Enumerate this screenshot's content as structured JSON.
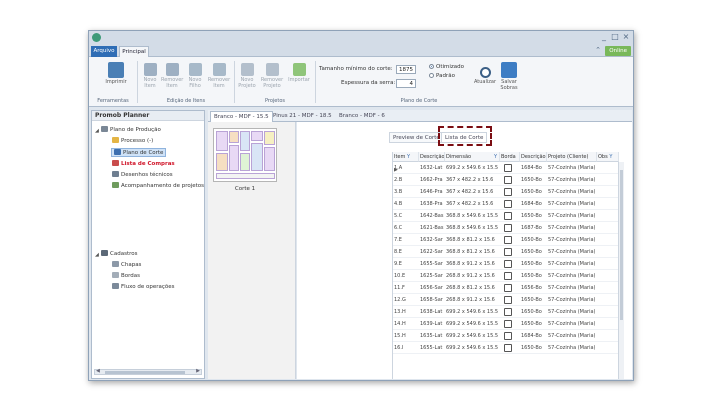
{
  "colors": {
    "accent": "#2f6db5",
    "highlight_red": "#d1162a",
    "focus_box": "#7b0d12",
    "badge_green": "#79b85a"
  },
  "window": {
    "controls": [
      "_",
      "□",
      "×"
    ]
  },
  "menu": {
    "tab_arquivo": "Arquivo",
    "tab_principal": "Principal",
    "badge": "Online"
  },
  "ribbon": {
    "buttons": [
      {
        "label": "Imprimir",
        "icon": "printer-icon"
      },
      {
        "label": "Novo Item",
        "icon": "new-item-icon"
      },
      {
        "label": "Remover Item",
        "icon": "remove-item-icon"
      },
      {
        "label": "Novo Filho",
        "icon": "new-child-icon"
      },
      {
        "label": "Remover Item",
        "icon": "remove-item-icon"
      },
      {
        "label": "Novo Projeto",
        "icon": "new-project-icon"
      },
      {
        "label": "Remover Projeto",
        "icon": "remove-project-icon"
      },
      {
        "label": "Importar",
        "icon": "import-icon"
      },
      {
        "label": "Atualizar",
        "icon": "refresh-icon"
      },
      {
        "label": "Salvar Sobras",
        "icon": "save-scraps-icon"
      }
    ],
    "groups": [
      "Ferramentas",
      "Edição de Itens",
      "Projetos",
      "Plano de Corte"
    ],
    "fields": {
      "tamanho_label": "Tamanho mínimo do corte:",
      "tamanho_value": "1875",
      "espessura_label": "Espessura da serra:",
      "espessura_value": "4"
    },
    "radios": [
      {
        "label": "Otimizado",
        "checked": true
      },
      {
        "label": "Padrão",
        "checked": false
      }
    ]
  },
  "left_panel": {
    "title": "Promob Planner",
    "tree": [
      {
        "label": "Plano de Produção",
        "icon": "production-plan-icon"
      },
      {
        "label": "Processo (-)",
        "icon": "process-icon"
      },
      {
        "label": "Plano de Corte",
        "icon": "cut-plan-icon"
      },
      {
        "label": "Lista de Compras",
        "icon": "shopping-list-icon"
      },
      {
        "label": "Desenhos técnicos",
        "icon": "technical-drawing-icon"
      },
      {
        "label": "Acompanhamento de projetos",
        "icon": "project-tracking-icon"
      },
      {
        "label": "Cadastros",
        "icon": "registry-icon"
      },
      {
        "label": "Chapas",
        "icon": "sheets-icon"
      },
      {
        "label": "Bordas",
        "icon": "edges-icon"
      },
      {
        "label": "Fluxo de operações",
        "icon": "operations-flow-icon"
      }
    ]
  },
  "doc_tabs": [
    "Branco - MDF - 15.5",
    "Pinus 21 - MDF - 18.5",
    "Branco - MDF - 6"
  ],
  "thumb": {
    "label": "Corte 1"
  },
  "sub_tabs": [
    "Preview de Corte",
    "Lista de Corte"
  ],
  "grid": {
    "headers": [
      "Item",
      "Descrição",
      "Dimensão",
      "Borda",
      "Descrição",
      "Projeto (Cliente)",
      "Obs"
    ],
    "rows": [
      [
        "1.A",
        "1632-Lat",
        "699.2 x 549.6 x 15.5",
        "1684-Bo",
        "57-Cozinha (Maria)"
      ],
      [
        "2.B",
        "1662-Pra",
        "367 x 482.2 x 15.6",
        "1650-Bo",
        "57-Cozinha (Maria)"
      ],
      [
        "3.B",
        "1646-Pra",
        "367 x 482.2 x 15.6",
        "1650-Bo",
        "57-Cozinha (Maria)"
      ],
      [
        "4.B",
        "1638-Pra",
        "367 x 482.2 x 15.6",
        "1684-Bo",
        "57-Cozinha (Maria)"
      ],
      [
        "5.C",
        "1642-Bas",
        "368.8 x 549.6 x 15.5",
        "1650-Bo",
        "57-Cozinha (Maria)"
      ],
      [
        "6.C",
        "1621-Bas",
        "368.8 x 549.6 x 15.5",
        "1687-Bo",
        "57-Cozinha (Maria)"
      ],
      [
        "7.E",
        "1632-Sar",
        "368.8 x 81.2 x 15.6",
        "1650-Bo",
        "57-Cozinha (Maria)"
      ],
      [
        "8.E",
        "1622-Sar",
        "368.8 x 81.2 x 15.6",
        "1650-Bo",
        "57-Cozinha (Maria)"
      ],
      [
        "9.E",
        "1655-Sar",
        "368.8 x 91.2 x 15.6",
        "1650-Bo",
        "57-Cozinha (Maria)"
      ],
      [
        "10.E",
        "1625-Sar",
        "268.8 x 91.2 x 15.6",
        "1650-Bo",
        "57-Cozinha (Maria)"
      ],
      [
        "11.F",
        "1656-Sar",
        "268.8 x 81.2 x 15.6",
        "1656-Bo",
        "57-Cozinha (Maria)"
      ],
      [
        "12.G",
        "1658-Sar",
        "268.8 x 91.2 x 15.6",
        "1650-Bo",
        "57-Cozinha (Maria)"
      ],
      [
        "13.H",
        "1638-Lat",
        "699.2 x 549.6 x 15.5",
        "1650-Bo",
        "57-Cozinha (Maria)"
      ],
      [
        "14.H",
        "1639-Lat",
        "699.2 x 549.6 x 15.5",
        "1650-Bo",
        "57-Cozinha (Maria)"
      ],
      [
        "15.H",
        "1635-Lat",
        "699.2 x 549.6 x 15.5",
        "1684-Bo",
        "57-Cozinha (Maria)"
      ],
      [
        "16.I",
        "1655-Lat",
        "699.2 x 549.6 x 15.5",
        "1650-Bo",
        "57-Cozinha (Maria)"
      ]
    ]
  }
}
